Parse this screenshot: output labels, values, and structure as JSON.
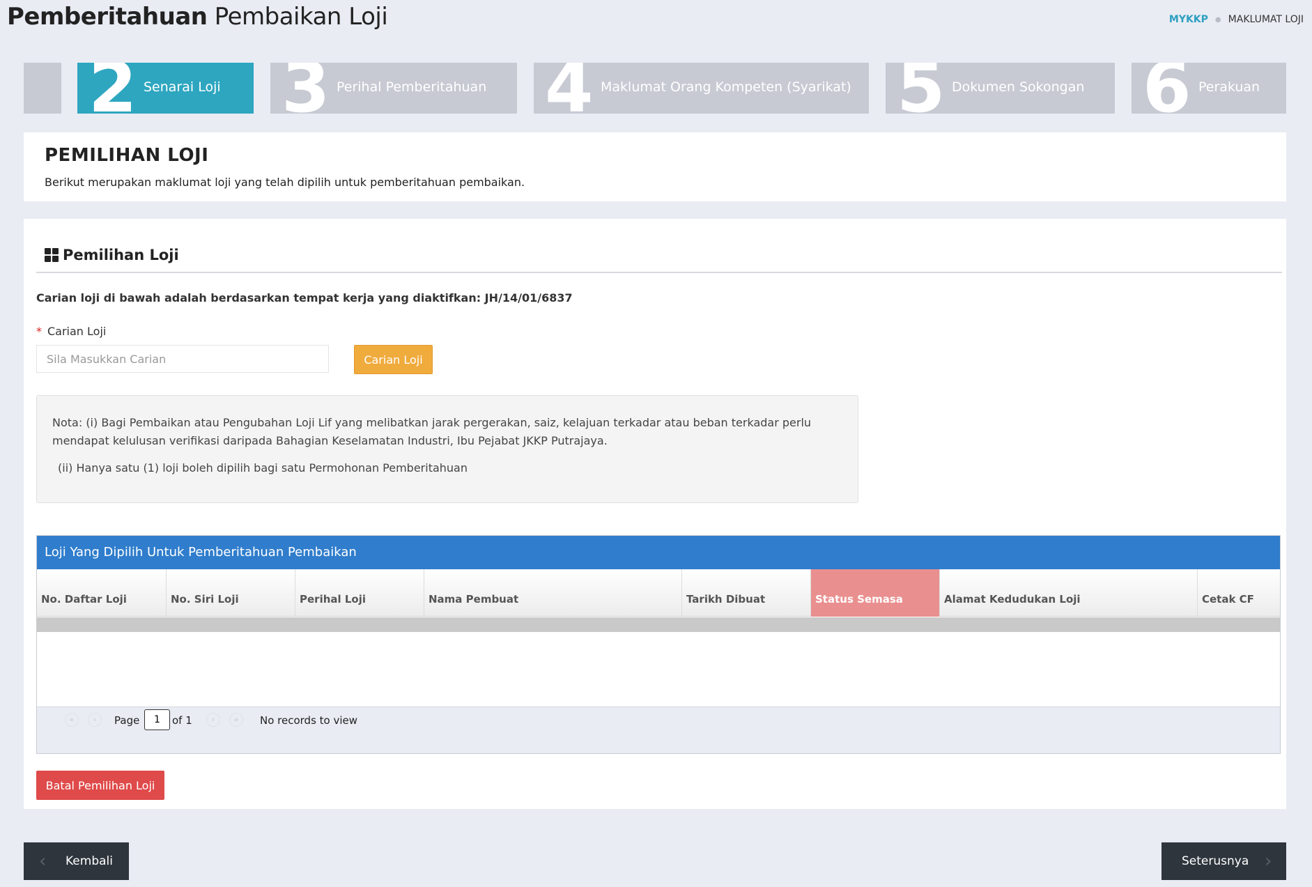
{
  "header": {
    "title_bold": "Pemberitahuan",
    "title_light": "Pembaikan Loji",
    "breadcrumb": [
      "MYKKP",
      "MAKLUMAT LOJI"
    ]
  },
  "steps": [
    {
      "num": "",
      "label": ""
    },
    {
      "num": "2",
      "label": "Senarai Loji",
      "active": true
    },
    {
      "num": "3",
      "label": "Perihal Pemberitahuan"
    },
    {
      "num": "4",
      "label": "Maklumat Orang Kompeten (Syarikat)"
    },
    {
      "num": "5",
      "label": "Dokumen Sokongan"
    },
    {
      "num": "6",
      "label": "Perakuan"
    }
  ],
  "intro": {
    "title": "PEMILIHAN LOJI",
    "desc": "Berikut merupakan maklumat loji yang telah dipilih untuk pemberitahuan pembaikan."
  },
  "section": {
    "title": "Pemilihan Loji",
    "info": "Carian loji di bawah adalah berdasarkan tempat kerja yang diaktifkan: JH/14/01/6837",
    "search_label": "Carian Loji",
    "search_placeholder": "Sila Masukkan Carian",
    "search_button": "Carian Loji",
    "note_1": "Nota: (i) Bagi Pembaikan atau Pengubahan Loji Lif yang melibatkan jarak pergerakan, saiz, kelajuan terkadar atau beban terkadar perlu mendapat kelulusan verifikasi daripada Bahagian Keselamatan Industri, Ibu Pejabat JKKP Putrajaya.",
    "note_2": "(ii) Hanya satu (1) loji boleh dipilih bagi satu Permohonan Pemberitahuan",
    "cancel_button": "Batal Pemilihan Loji"
  },
  "grid": {
    "caption": "Loji Yang Dipilih Untuk Pemberitahuan Pembaikan",
    "columns": [
      "No. Daftar Loji",
      "No. Siri Loji",
      "Perihal Loji",
      "Nama Pembuat",
      "Tarikh Dibuat",
      "Status Semasa",
      "Alamat Kedudukan Loji",
      "Cetak CF"
    ],
    "pager": {
      "page_label": "Page",
      "page_value": "1",
      "of_label": "of 1",
      "records": "No records to view"
    }
  },
  "footer": {
    "back": "Kembali",
    "next": "Seterusnya"
  },
  "colors": {
    "accent": "#2ea6c0",
    "step_inactive": "#c7cad3",
    "grid_caption": "#2f7dcc",
    "search_button": "#f0ab3d",
    "cancel_button": "#df4a4a",
    "status_header": "#ea8f8f",
    "nav_button": "#2f353d"
  }
}
